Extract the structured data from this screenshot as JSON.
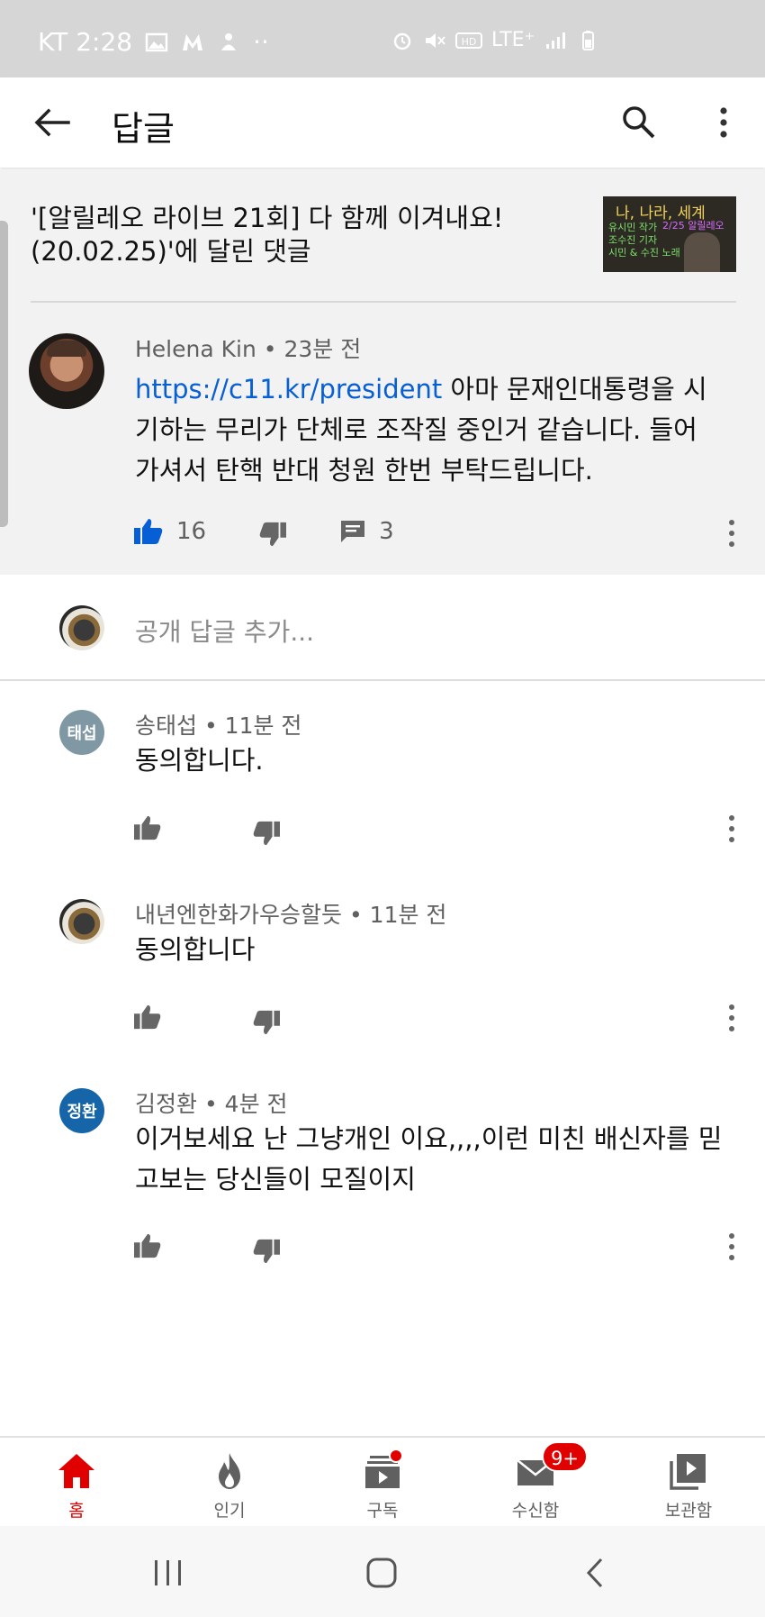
{
  "status_bar": {
    "carrier_time": "KT 2:28",
    "dots": "··",
    "network": "LTE⁺"
  },
  "app_bar": {
    "title": "답글"
  },
  "parent_comment": {
    "video_title": "'[알릴레오 라이브 21회] 다 함께 이겨내요!(20.02.25)'에 달린 댓글",
    "thumbnail_text": "나, 나라, 세계",
    "thumbnail_sub": "2/25 알릴레오",
    "thumbnail_lines": "유시민 작가\n조수진 기자\n시민 & 수진 노래",
    "author": "Helena Kin",
    "time": "23분 전",
    "link": "https://c11.kr/president",
    "text": " 아마 문재인대통령을 시기하는 무리가 단체로 조작질 중인거 같습니다. 들어가셔서 탄핵 반대 청원 한번 부탁드립니다.",
    "likes": "16",
    "reply_count": "3"
  },
  "reply_input": {
    "placeholder": "공개 답글 추가..."
  },
  "replies": [
    {
      "avatar_text": "태섭",
      "avatar_color": "#7f98a3",
      "author": "송태섭",
      "time": "11분 전",
      "text": "동의합니다."
    },
    {
      "avatar_text": "",
      "avatar_color": "#333333",
      "author": "내년엔한화가우승할듯",
      "time": "11분 전",
      "text": "동의합니다"
    },
    {
      "avatar_text": "정환",
      "avatar_color": "#1565a8",
      "author": "김정환",
      "time": "4분 전",
      "text": "이거보세요  난 그냥개인 이요,,,,이런 미친 배신자를 믿고보는 당신들이 모질이지"
    }
  ],
  "separator": "•",
  "bottom_nav": {
    "items": [
      {
        "label": "홈",
        "icon": "home-icon",
        "active": true
      },
      {
        "label": "인기",
        "icon": "fire-icon",
        "active": false
      },
      {
        "label": "구독",
        "icon": "subscriptions-icon",
        "active": false
      },
      {
        "label": "수신함",
        "icon": "inbox-icon",
        "active": false,
        "badge": "9+"
      },
      {
        "label": "보관함",
        "icon": "library-icon",
        "active": false
      }
    ]
  },
  "colors": {
    "accent": "#e00000",
    "link": "#065fd4",
    "like_active": "#065fd4",
    "muted": "#606060"
  }
}
